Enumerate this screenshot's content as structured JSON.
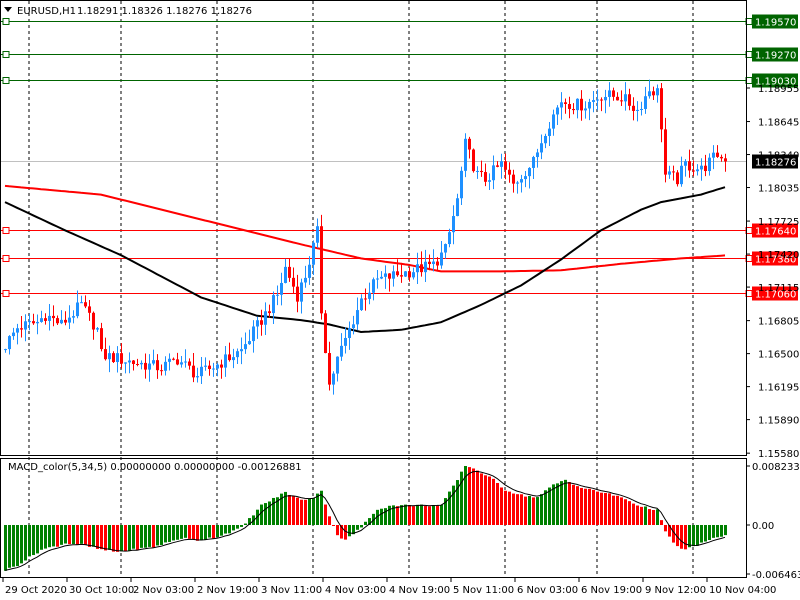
{
  "header": {
    "symbol_tf": "EURUSD,H1",
    "ohlc": "1.18291 1.18326 1.18276 1.18276"
  },
  "macd_header": "MACD_color(5,34,5) 0.00000000 0.00000000 -0.00126881",
  "colors": {
    "up": "#1E90FF",
    "down": "#FF0000",
    "ma_fast": "#000000",
    "ma_slow": "#FF0000",
    "macd_up": "#008000",
    "macd_down": "#FF0000",
    "res": "#006400",
    "sup": "#FF0000"
  },
  "chart_data": [
    {
      "type": "candlestick",
      "title": "EURUSD,H1",
      "bars": 181,
      "ylim": [
        1.1553,
        1.1975
      ],
      "y_ticks": [
        "1.18955",
        "1.18645",
        "1.18340",
        "1.18035",
        "1.17725",
        "1.17420",
        "1.17115",
        "1.16805",
        "1.16500",
        "1.16195",
        "1.15890",
        "1.15580"
      ],
      "x_ticks": [
        {
          "bar": 0,
          "label": "29 Oct 2020"
        },
        {
          "bar": 16,
          "label": "30 Oct 10:00"
        },
        {
          "bar": 32,
          "label": "2 Nov 03:00"
        },
        {
          "bar": 48,
          "label": "2 Nov 19:00"
        },
        {
          "bar": 64,
          "label": "3 Nov 11:00"
        },
        {
          "bar": 80,
          "label": "4 Nov 03:00"
        },
        {
          "bar": 96,
          "label": "4 Nov 19:00"
        },
        {
          "bar": 112,
          "label": "5 Nov 11:00"
        },
        {
          "bar": 128,
          "label": "6 Nov 03:00"
        },
        {
          "bar": 144,
          "label": "6 Nov 19:00"
        },
        {
          "bar": 160,
          "label": "9 Nov 12:00"
        },
        {
          "bar": 176,
          "label": "10 Nov 04:00"
        }
      ],
      "close_anchors": [
        [
          0,
          1.1658
        ],
        [
          3,
          1.1674
        ],
        [
          8,
          1.1679
        ],
        [
          10,
          1.1686
        ],
        [
          14,
          1.1677
        ],
        [
          19,
          1.1695
        ],
        [
          23,
          1.1672
        ],
        [
          24,
          1.1649
        ],
        [
          32,
          1.1642
        ],
        [
          39,
          1.1637
        ],
        [
          43,
          1.1645
        ],
        [
          48,
          1.163
        ],
        [
          53,
          1.164
        ],
        [
          59,
          1.1653
        ],
        [
          64,
          1.1681
        ],
        [
          68,
          1.1704
        ],
        [
          70,
          1.1729
        ],
        [
          73,
          1.1704
        ],
        [
          75,
          1.1722
        ],
        [
          78,
          1.1762
        ],
        [
          79,
          1.169
        ],
        [
          81,
          1.1621
        ],
        [
          83,
          1.1645
        ],
        [
          85,
          1.1663
        ],
        [
          89,
          1.17
        ],
        [
          93,
          1.1718
        ],
        [
          97,
          1.1722
        ],
        [
          102,
          1.1727
        ],
        [
          107,
          1.1732
        ],
        [
          110,
          1.1746
        ],
        [
          113,
          1.1792
        ],
        [
          115,
          1.1843
        ],
        [
          118,
          1.1815
        ],
        [
          120,
          1.1811
        ],
        [
          124,
          1.1825
        ],
        [
          127,
          1.1806
        ],
        [
          129,
          1.1815
        ],
        [
          132,
          1.1827
        ],
        [
          135,
          1.1857
        ],
        [
          139,
          1.1884
        ],
        [
          142,
          1.188
        ],
        [
          145,
          1.188
        ],
        [
          149,
          1.1889
        ],
        [
          154,
          1.1887
        ],
        [
          158,
          1.1875
        ],
        [
          161,
          1.1894
        ],
        [
          163,
          1.1892
        ],
        [
          164,
          1.1861
        ],
        [
          165,
          1.1815
        ],
        [
          168,
          1.1811
        ],
        [
          170,
          1.1825
        ],
        [
          174,
          1.182
        ],
        [
          178,
          1.1834
        ],
        [
          180,
          1.18276
        ]
      ],
      "ma_fast": [
        [
          0,
          1.179
        ],
        [
          15,
          1.1764
        ],
        [
          29,
          1.1741
        ],
        [
          49,
          1.1702
        ],
        [
          63,
          1.1685
        ],
        [
          74,
          1.1681
        ],
        [
          81,
          1.1677
        ],
        [
          89,
          1.167
        ],
        [
          99,
          1.1672
        ],
        [
          109,
          1.1679
        ],
        [
          119,
          1.1695
        ],
        [
          129,
          1.1713
        ],
        [
          139,
          1.1737
        ],
        [
          149,
          1.1764
        ],
        [
          159,
          1.1783
        ],
        [
          164,
          1.179
        ],
        [
          174,
          1.1797
        ],
        [
          181,
          1.1805
        ]
      ],
      "ma_slow": [
        [
          0,
          1.1805
        ],
        [
          24,
          1.1797
        ],
        [
          49,
          1.1774
        ],
        [
          74,
          1.1751
        ],
        [
          89,
          1.1738
        ],
        [
          101,
          1.1732
        ],
        [
          109,
          1.1726
        ],
        [
          124,
          1.1726
        ],
        [
          139,
          1.1727
        ],
        [
          154,
          1.1733
        ],
        [
          169,
          1.1738
        ],
        [
          181,
          1.1741
        ]
      ],
      "levels": [
        {
          "price": 1.1957,
          "label": "1.19570",
          "kind": "res"
        },
        {
          "price": 1.1927,
          "label": "1.19270",
          "kind": "res"
        },
        {
          "price": 1.1903,
          "label": "1.19030",
          "kind": "res"
        },
        {
          "price": 1.1764,
          "label": "1.17640",
          "kind": "sup"
        },
        {
          "price": 1.1738,
          "label": "1.17380",
          "kind": "sup"
        },
        {
          "price": 1.1706,
          "label": "1.17060",
          "kind": "sup"
        }
      ],
      "current_price": "1.18276"
    },
    {
      "type": "bar",
      "title": "MACD_color(5,34,5)",
      "ylim": [
        -0.006463,
        0.0082333
      ],
      "y_ticks": [
        "0.0082333",
        "0.00",
        "-0.006463"
      ],
      "hist_anchors": [
        [
          0,
          -0.0062
        ],
        [
          3,
          -0.0055
        ],
        [
          9,
          -0.0034
        ],
        [
          14,
          -0.0027
        ],
        [
          15,
          -0.0025
        ],
        [
          19,
          -0.0027
        ],
        [
          24,
          -0.0034
        ],
        [
          28,
          -0.0037
        ],
        [
          32,
          -0.0034
        ],
        [
          37,
          -0.003
        ],
        [
          44,
          -0.0018
        ],
        [
          48,
          -0.0021
        ],
        [
          53,
          -0.0016
        ],
        [
          59,
          -0.0004
        ],
        [
          64,
          0.0027
        ],
        [
          70,
          0.0045
        ],
        [
          74,
          0.0034
        ],
        [
          77,
          0.0038
        ],
        [
          79,
          0.0048
        ],
        [
          80,
          0.0027
        ],
        [
          83,
          -0.0014
        ],
        [
          85,
          -0.0021
        ],
        [
          89,
          -0.0003
        ],
        [
          93,
          0.0022
        ],
        [
          97,
          0.0027
        ],
        [
          104,
          0.0027
        ],
        [
          109,
          0.0027
        ],
        [
          113,
          0.0062
        ],
        [
          115,
          0.0082
        ],
        [
          118,
          0.0075
        ],
        [
          122,
          0.0062
        ],
        [
          125,
          0.0048
        ],
        [
          129,
          0.0041
        ],
        [
          133,
          0.0038
        ],
        [
          137,
          0.0055
        ],
        [
          140,
          0.0062
        ],
        [
          144,
          0.0051
        ],
        [
          149,
          0.0045
        ],
        [
          154,
          0.0038
        ],
        [
          159,
          0.0025
        ],
        [
          163,
          0.0021
        ],
        [
          165,
          -0.001
        ],
        [
          168,
          -0.003
        ],
        [
          170,
          -0.0034
        ],
        [
          174,
          -0.0025
        ],
        [
          179,
          -0.0015
        ],
        [
          181,
          -0.0014
        ]
      ]
    }
  ]
}
